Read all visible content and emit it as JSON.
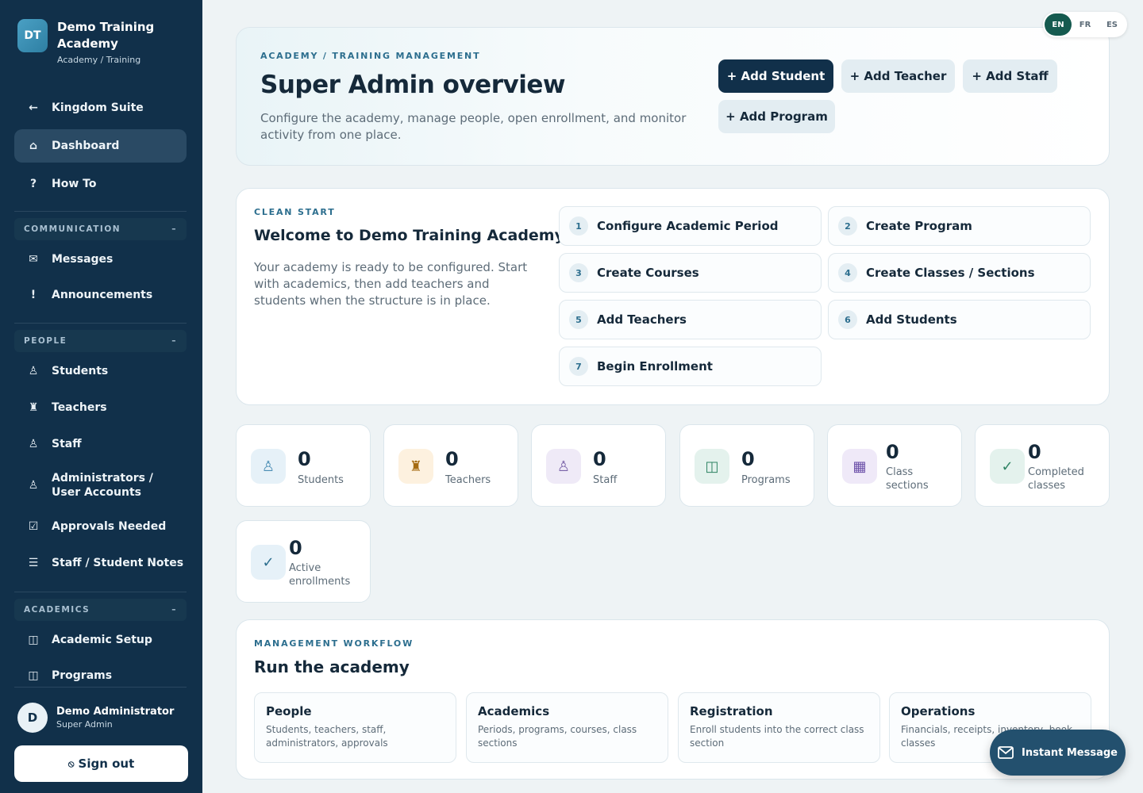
{
  "brand": {
    "initials": "DT",
    "name": "Demo Training Academy",
    "subtitle": "Academy / Training"
  },
  "nav": {
    "kingdom_suite": "Kingdom Suite",
    "dashboard": "Dashboard",
    "how_to": "How To",
    "sections": {
      "communication": "COMMUNICATION",
      "people": "PEOPLE",
      "academics": "ACADEMICS",
      "collapse_glyph": "–"
    },
    "messages": "Messages",
    "announcements": "Announcements",
    "students": "Students",
    "teachers": "Teachers",
    "staff": "Staff",
    "administrators": "Administrators / User Accounts",
    "approvals": "Approvals Needed",
    "notes": "Staff / Student Notes",
    "academic_setup": "Academic Setup",
    "programs": "Programs"
  },
  "user": {
    "initial": "D",
    "name": "Demo Administrator",
    "role": "Super Admin",
    "signout": "Sign out"
  },
  "hero": {
    "eyebrow": "ACADEMY / TRAINING MANAGEMENT",
    "title": "Super Admin overview",
    "description": "Configure the academy, manage people, open enrollment, and monitor activity from one place.",
    "buttons": {
      "add_student": "+ Add Student",
      "add_teacher": "+ Add Teacher",
      "add_staff": "+ Add Staff",
      "add_program": "+ Add Program"
    }
  },
  "clean_start": {
    "eyebrow": "CLEAN START",
    "title": "Welcome to Demo Training Academy",
    "description": "Your academy is ready to be configured. Start with academics, then add teachers and students when the structure is in place.",
    "steps": [
      {
        "num": "1",
        "label": "Configure Academic Period"
      },
      {
        "num": "2",
        "label": "Create Program"
      },
      {
        "num": "3",
        "label": "Create Courses"
      },
      {
        "num": "4",
        "label": "Create Classes / Sections"
      },
      {
        "num": "5",
        "label": "Add Teachers"
      },
      {
        "num": "6",
        "label": "Add Students"
      },
      {
        "num": "7",
        "label": "Begin Enrollment"
      }
    ]
  },
  "stats": [
    {
      "value": "0",
      "label": "Students",
      "icon": "student-icon",
      "color": "#e6f1f8"
    },
    {
      "value": "0",
      "label": "Teachers",
      "icon": "teacher-icon",
      "color": "#fdf1df"
    },
    {
      "value": "0",
      "label": "Staff",
      "icon": "staff-icon",
      "color": "#efeaf7"
    },
    {
      "value": "0",
      "label": "Programs",
      "icon": "programs-icon",
      "color": "#e4f2ed"
    },
    {
      "value": "0",
      "label": "Class sections",
      "icon": "grid-icon",
      "color": "#efe9f8"
    },
    {
      "value": "0",
      "label": "Completed classes",
      "icon": "check-icon",
      "color": "#e4f2ed"
    },
    {
      "value": "0",
      "label": "Active enrollments",
      "icon": "check-icon",
      "color": "#e6f1f8"
    }
  ],
  "workflow": {
    "eyebrow": "MANAGEMENT WORKFLOW",
    "title": "Run the academy",
    "cards": [
      {
        "name": "People",
        "desc": "Students, teachers, staff, administrators, approvals"
      },
      {
        "name": "Academics",
        "desc": "Periods, programs, courses, class sections"
      },
      {
        "name": "Registration",
        "desc": "Enroll students into the correct class section"
      },
      {
        "name": "Operations",
        "desc": "Financials, receipts, inventory, book classes"
      }
    ]
  },
  "lang": {
    "en": "EN",
    "fr": "FR",
    "es": "ES"
  },
  "instant_message": "Instant Message"
}
